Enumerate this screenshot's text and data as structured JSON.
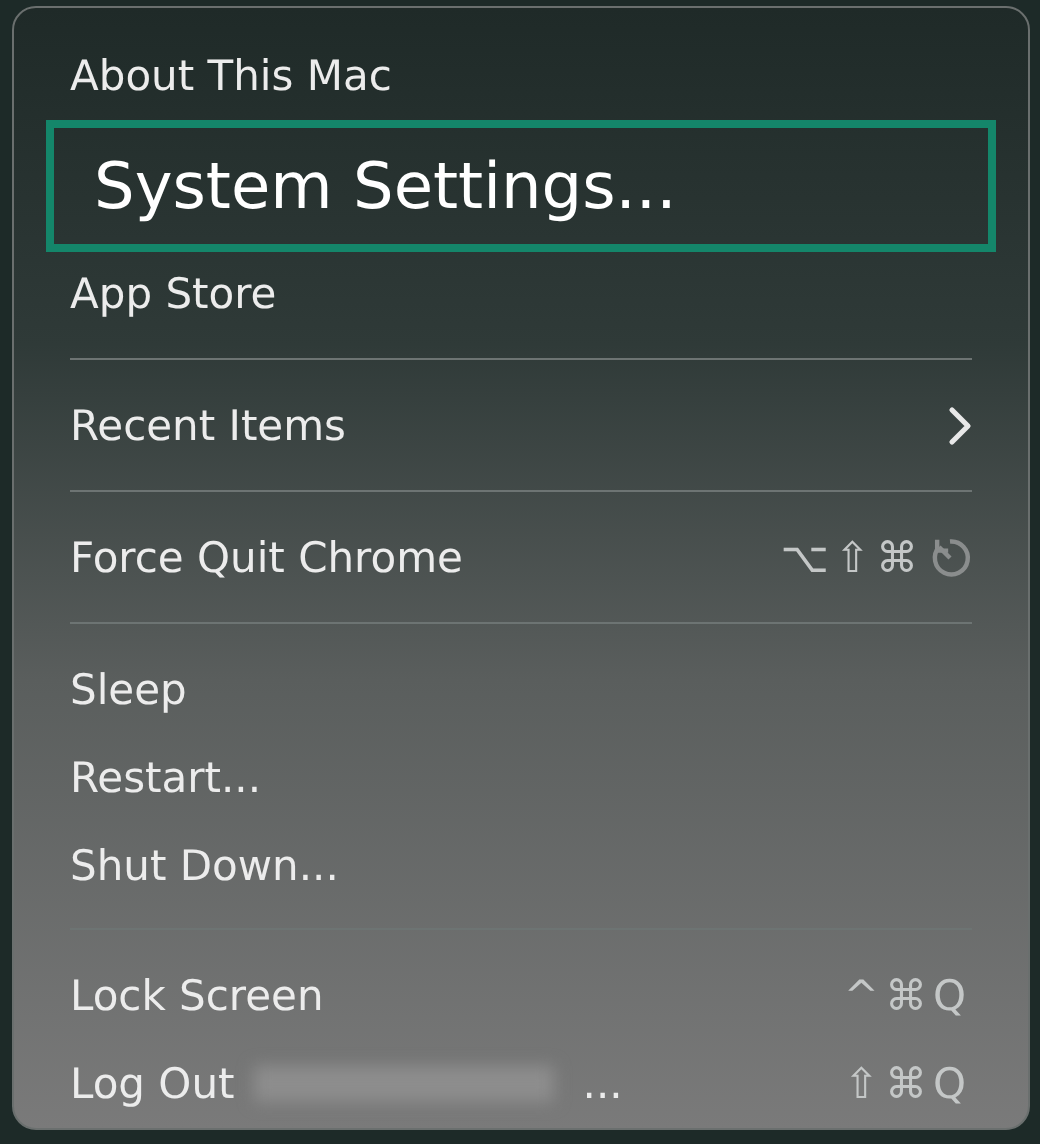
{
  "menu": {
    "items": [
      {
        "kind": "item",
        "label": "About This Mac",
        "selected": false
      },
      {
        "kind": "item",
        "label": "System Settings...",
        "selected": true
      },
      {
        "kind": "item",
        "label": "App Store",
        "selected": false
      },
      {
        "kind": "separator"
      },
      {
        "kind": "item",
        "label": "Recent Items",
        "selected": false,
        "submenu": true
      },
      {
        "kind": "separator"
      },
      {
        "kind": "item",
        "label": "Force Quit Chrome",
        "selected": false,
        "shortcut": "⌥⇧⌘",
        "restart_icon": true
      },
      {
        "kind": "separator"
      },
      {
        "kind": "item",
        "label": "Sleep",
        "selected": false
      },
      {
        "kind": "item",
        "label": "Restart...",
        "selected": false
      },
      {
        "kind": "item",
        "label": "Shut Down...",
        "selected": false
      },
      {
        "kind": "separator"
      },
      {
        "kind": "item",
        "label": "Lock Screen",
        "selected": false,
        "shortcut": "^⌘Q"
      },
      {
        "kind": "item",
        "label": "Log Out",
        "selected": false,
        "redacted": true,
        "suffix": "...",
        "shortcut": "⇧⌘Q"
      }
    ]
  }
}
